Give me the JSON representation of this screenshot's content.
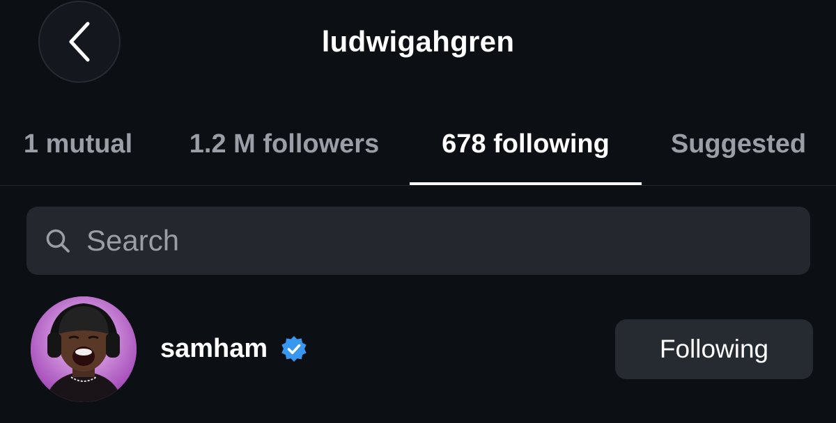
{
  "header": {
    "title": "ludwigahgren",
    "back_icon": "chevron-left-icon"
  },
  "tabs": [
    {
      "label": "1 mutual",
      "active": false
    },
    {
      "label": "1.2 M followers",
      "active": false
    },
    {
      "label": "678 following",
      "active": true
    },
    {
      "label": "Suggested",
      "active": false
    }
  ],
  "search": {
    "placeholder": "Search",
    "value": "",
    "icon": "search-icon"
  },
  "following_list": [
    {
      "username": "samham",
      "verified": true,
      "button_label": "Following",
      "avatar_icon": "avatar"
    }
  ],
  "colors": {
    "background": "#0c0f14",
    "search_bg": "#24272d",
    "button_bg": "#262a31",
    "inactive_tab": "#9a9ea6",
    "verified": "#3897f0",
    "avatar_bg": "#c06fd3"
  }
}
